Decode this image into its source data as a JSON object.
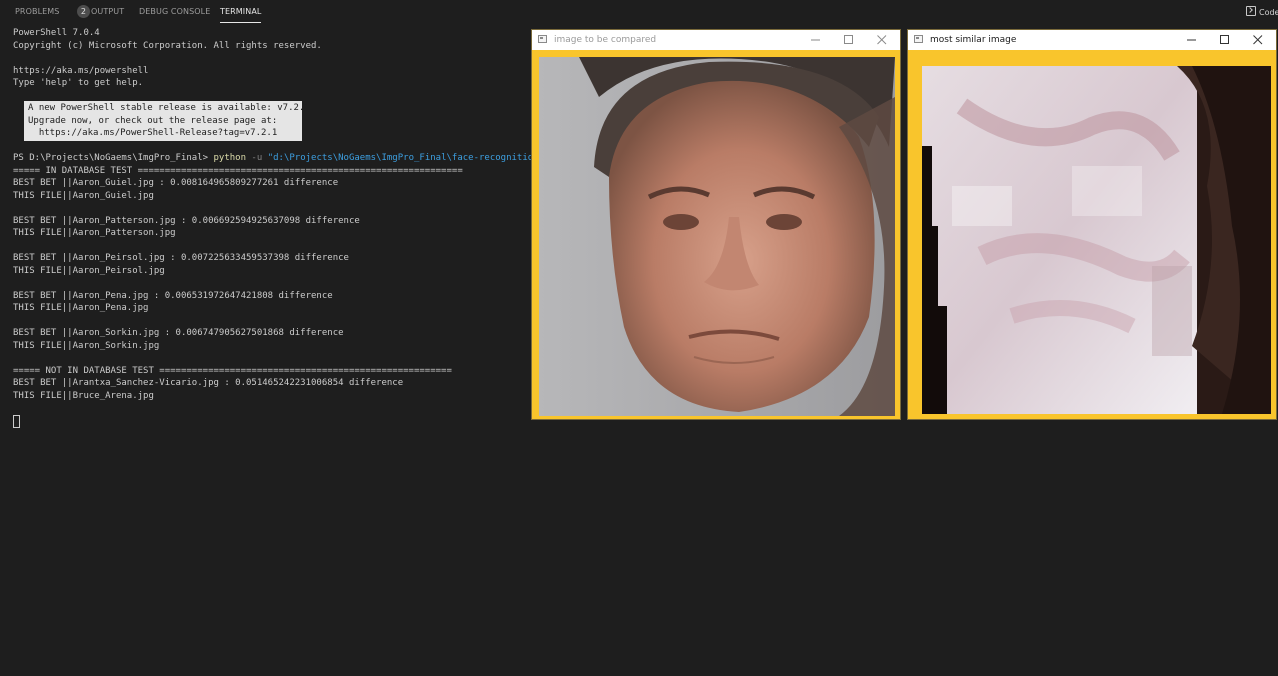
{
  "panel": {
    "tabs": [
      {
        "label": "PROBLEMS",
        "badge": "2"
      },
      {
        "label": "OUTPUT"
      },
      {
        "label": "DEBUG CONSOLE"
      },
      {
        "label": "TERMINAL"
      }
    ],
    "active_tab": "TERMINAL",
    "right_button_label": "Code",
    "right_button_icon": "terminal-code-icon"
  },
  "terminal": {
    "lines": [
      "PowerShell 7.0.4",
      "Copyright (c) Microsoft Corporation. All rights reserved.",
      "",
      "https://aka.ms/powershell",
      "Type 'help' to get help."
    ],
    "notice": [
      "A new PowerShell stable release is available: v7.2.1",
      "Upgrade now, or check out the release page at:",
      "  https://aka.ms/PowerShell-Release?tag=v7.2.1"
    ],
    "prompt": "PS D:\\Projects\\NoGaems\\ImgPro_Final> ",
    "command": "python",
    "command_flag": " -u ",
    "command_arg": "\"d:\\Projects\\NoGaems\\ImgPro_Final\\face-recognition.py\"",
    "output": [
      "===== IN DATABASE TEST ============================================================",
      "BEST BET ||Aaron_Guiel.jpg : 0.008164965809277261 difference",
      "THIS FILE||Aaron_Guiel.jpg",
      "",
      "BEST BET ||Aaron_Patterson.jpg : 0.006692594925637098 difference",
      "THIS FILE||Aaron_Patterson.jpg",
      "",
      "BEST BET ||Aaron_Peirsol.jpg : 0.007225633459537398 difference",
      "THIS FILE||Aaron_Peirsol.jpg",
      "",
      "BEST BET ||Aaron_Pena.jpg : 0.006531972647421808 difference",
      "THIS FILE||Aaron_Pena.jpg",
      "",
      "BEST BET ||Aaron_Sorkin.jpg : 0.006747905627501868 difference",
      "THIS FILE||Aaron_Sorkin.jpg",
      "",
      "===== NOT IN DATABASE TEST ======================================================",
      "BEST BET ||Arantxa_Sanchez-Vicario.jpg : 0.051465242231006854 difference",
      "THIS FILE||Bruce_Arena.jpg"
    ]
  },
  "windows": [
    {
      "title": "image to be compared",
      "title_color": "#9a9a9a",
      "frame_color": "#f9c52c"
    },
    {
      "title": "most similar image",
      "title_color": "#1a1a1a",
      "frame_color": "#f9c52c"
    }
  ]
}
